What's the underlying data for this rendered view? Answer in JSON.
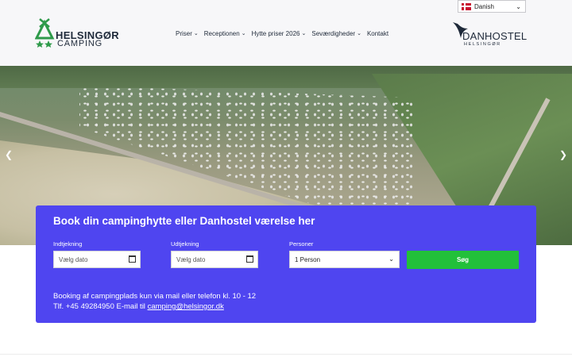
{
  "header": {
    "logo_left": {
      "line1": "HELSINGØR",
      "line2": "CAMPING",
      "color": "#2e9a4a"
    },
    "nav": [
      {
        "label": "Priser",
        "has_dropdown": true
      },
      {
        "label": "Receptionen",
        "has_dropdown": true
      },
      {
        "label": "Hytte priser 2026",
        "has_dropdown": true
      },
      {
        "label": "Seværdigheder",
        "has_dropdown": true
      },
      {
        "label": "Kontakt",
        "has_dropdown": false
      }
    ],
    "language": {
      "selected": "Danish",
      "flag_icon": "danish-flag-icon"
    },
    "logo_right": {
      "line1": "DANHOSTEL",
      "line2": "HELSINGØR"
    }
  },
  "hero": {
    "prev_icon": "chevron-left-icon",
    "next_icon": "chevron-right-icon"
  },
  "booking": {
    "title": "Book din campinghytte eller Danhostel værelse her",
    "checkin": {
      "label": "Indtjekning",
      "placeholder": "Vælg dato"
    },
    "checkout": {
      "label": "Udtjekning",
      "placeholder": "Vælg dato"
    },
    "persons": {
      "label": "Personer",
      "value": "1 Person"
    },
    "search_button": "Søg",
    "info_line1": "Booking af campingplads kun via mail eller telefon kl. 10 - 12",
    "info_line2_prefix": "Tlf. +45 49284950 E-mail til ",
    "email": "camping@helsingor.dk",
    "panel_color": "#4f45f0",
    "button_color": "#22c03a"
  }
}
